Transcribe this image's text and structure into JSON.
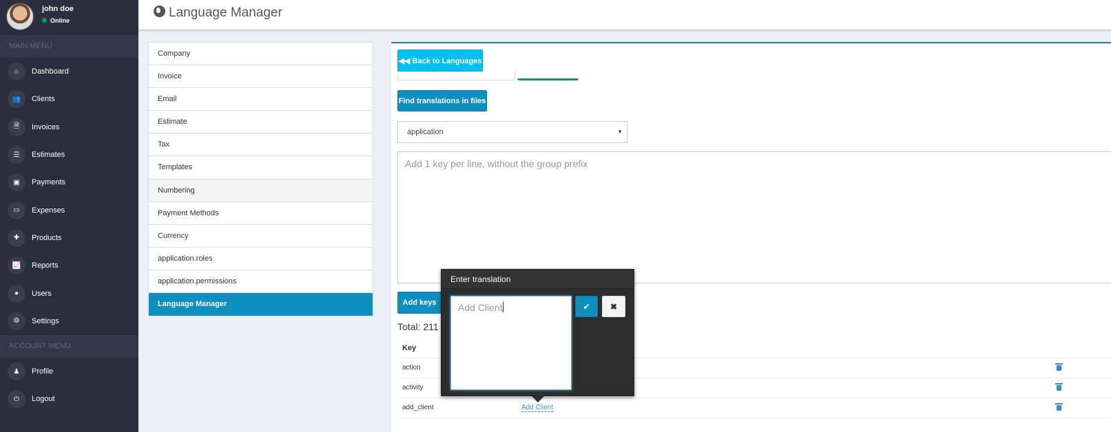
{
  "user": {
    "name": "john doe",
    "status": "Online"
  },
  "sidebar": {
    "main_header": "MAIN MENU",
    "main_items": [
      {
        "label": "Dashboard",
        "icon": "home-icon",
        "glyph": "⌂"
      },
      {
        "label": "Clients",
        "icon": "users-icon",
        "glyph": "👥"
      },
      {
        "label": "Invoices",
        "icon": "invoice-file-icon",
        "glyph": "🗎"
      },
      {
        "label": "Estimates",
        "icon": "list-icon",
        "glyph": "☰"
      },
      {
        "label": "Payments",
        "icon": "money-icon",
        "glyph": "▣"
      },
      {
        "label": "Expenses",
        "icon": "credit-card-icon",
        "glyph": "▭"
      },
      {
        "label": "Products",
        "icon": "puzzle-icon",
        "glyph": "✚"
      },
      {
        "label": "Reports",
        "icon": "chart-icon",
        "glyph": "📈"
      },
      {
        "label": "Users",
        "icon": "user-icon",
        "glyph": "●"
      },
      {
        "label": "Settings",
        "icon": "gears-icon",
        "glyph": "⚙"
      }
    ],
    "account_header": "ACCOUNT MENU",
    "account_items": [
      {
        "label": "Profile",
        "icon": "profile-icon",
        "glyph": "♟"
      },
      {
        "label": "Logout",
        "icon": "power-icon",
        "glyph": "⏻"
      }
    ]
  },
  "header": {
    "title": "Language Manager"
  },
  "settings_menu": [
    {
      "label": "Company",
      "state": ""
    },
    {
      "label": "Invoice",
      "state": ""
    },
    {
      "label": "Email",
      "state": ""
    },
    {
      "label": "Estimate",
      "state": ""
    },
    {
      "label": "Tax",
      "state": ""
    },
    {
      "label": "Templates",
      "state": ""
    },
    {
      "label": "Numbering",
      "state": "hover"
    },
    {
      "label": "Payment Methods",
      "state": ""
    },
    {
      "label": "Currency",
      "state": ""
    },
    {
      "label": "application.roles",
      "state": ""
    },
    {
      "label": "application.permissions",
      "state": ""
    },
    {
      "label": "Language Manager",
      "state": "active"
    }
  ],
  "main": {
    "back_button": "◀◀ Back to Languages",
    "find_button": "Find translations in files",
    "group_select": "application",
    "keys_placeholder": "Add 1 key per line, without the group prefix",
    "add_keys_button": "Add keys",
    "total": "Total: 211",
    "table_header_key": "Key",
    "rows": [
      {
        "key": "action",
        "value": ""
      },
      {
        "key": "activity",
        "value": ""
      },
      {
        "key": "add_client",
        "value": "Add Client"
      }
    ]
  },
  "popover": {
    "title": "Enter translation",
    "value": "Add Client",
    "ok_glyph": "✔",
    "cancel_glyph": "✖"
  }
}
